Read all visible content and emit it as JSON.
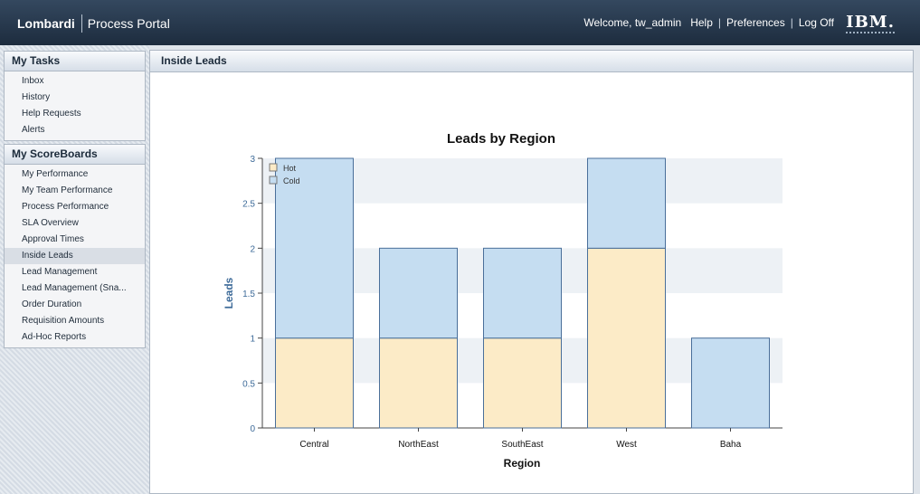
{
  "header": {
    "brand_primary": "Lombardi",
    "brand_secondary": "Process Portal",
    "welcome": "Welcome, tw_admin",
    "help": "Help",
    "preferences": "Preferences",
    "logoff": "Log Off",
    "logo_text": "IBM."
  },
  "sidebar": {
    "my_tasks": {
      "title": "My Tasks",
      "items": [
        "Inbox",
        "History",
        "Help Requests",
        "Alerts"
      ]
    },
    "scoreboards": {
      "title": "My ScoreBoards",
      "items": [
        "My Performance",
        "My Team Performance",
        "Process Performance",
        "SLA Overview",
        "Approval Times",
        "Inside Leads",
        "Lead Management",
        "Lead Management (Sna...",
        "Order Duration",
        "Requisition Amounts",
        "Ad-Hoc Reports"
      ],
      "active_index": 5
    }
  },
  "main": {
    "title": "Inside Leads"
  },
  "chart_data": {
    "type": "bar",
    "stacked": true,
    "title": "Leads by Region",
    "xlabel": "Region",
    "ylabel": "Leads",
    "categories": [
      "Central",
      "NorthEast",
      "SouthEast",
      "West",
      "Baha"
    ],
    "series": [
      {
        "name": "Hot",
        "values": [
          1,
          1,
          1,
          2,
          0
        ],
        "color": "#fcebc7"
      },
      {
        "name": "Cold",
        "values": [
          2,
          1,
          1,
          1,
          1
        ],
        "color": "#c5ddf1"
      }
    ],
    "ylim": [
      0,
      3
    ],
    "yticks": [
      "0",
      "0.5",
      "1",
      "1.5",
      "2",
      "2.5",
      "3"
    ],
    "legend_position": "top-left",
    "colors": {
      "bar_stroke": "#4a6f9a",
      "band": "#edf1f5",
      "axis_label": "#3e6b99"
    }
  }
}
